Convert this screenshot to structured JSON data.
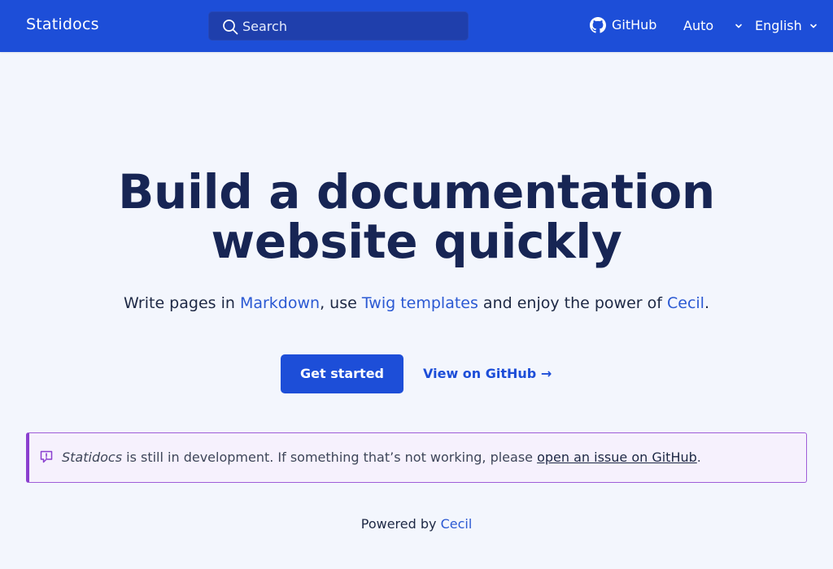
{
  "header": {
    "brand": "Statidocs",
    "search": {
      "placeholder": "Search",
      "value": ""
    },
    "github_label": "GitHub",
    "theme_value": "Auto",
    "language_value": "English"
  },
  "hero": {
    "title_line1": "Build a documentation",
    "title_line2": "website quickly",
    "tagline": {
      "part1": "Write pages in ",
      "link1": "Markdown",
      "part2": ", use ",
      "link2": "Twig templates",
      "part3": " and enjoy the power of ",
      "link3": "Cecil",
      "part4": "."
    },
    "primary_button": "Get started",
    "secondary_link": "View on GitHub →"
  },
  "notice": {
    "name": "Statidocs",
    "text": " is still in development. If something that’s not working, please ",
    "link": "open an issue on GitHub",
    "end": "."
  },
  "footer": {
    "prefix": "Powered by ",
    "link": "Cecil"
  },
  "colors": {
    "header_bg": "#1d4ed8",
    "page_bg": "#f3f6fd",
    "title": "#172554",
    "link": "#2b59d3",
    "notice_border": "#8a3fcf",
    "notice_bg": "#f6f1fd"
  },
  "icons": {
    "search": "search-icon",
    "github": "github-icon",
    "chevron": "chevron-down-icon",
    "notice": "alert-message-icon"
  }
}
